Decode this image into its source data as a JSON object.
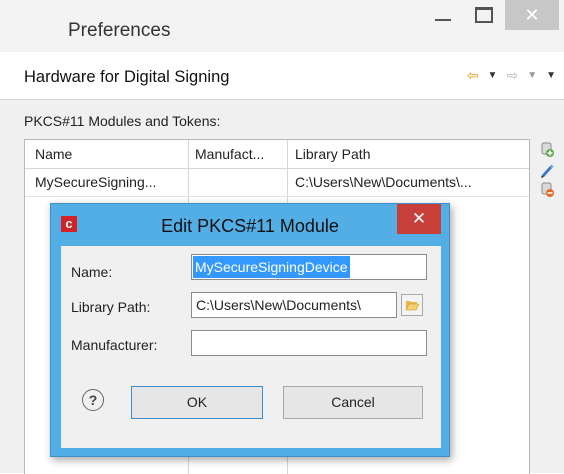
{
  "window": {
    "title": "Preferences",
    "minimize_icon": "minimize-icon",
    "maximize_icon": "maximize-icon",
    "close_label": "✕"
  },
  "page": {
    "header_title": "Hardware for Digital Signing",
    "section_label": "PKCS#11 Modules and Tokens:"
  },
  "nav": {
    "back_glyph": "⇦",
    "forward_glyph": "⇨",
    "dropdown_glyph": "▼"
  },
  "table": {
    "columns": [
      "Name",
      "Manufact...",
      "Library Path"
    ],
    "rows": [
      {
        "name": "MySecureSigning...",
        "manufacturer": "",
        "library_path": "C:\\Users\\New\\Documents\\..."
      }
    ]
  },
  "side_tools": [
    "add-module-icon",
    "edit-pencil-icon",
    "remove-module-icon"
  ],
  "dialog": {
    "title": "Edit PKCS#11 Module",
    "app_icon_letter": "c",
    "close_label": "✕",
    "fields": {
      "name_label": "Name:",
      "name_value": "MySecureSigningDevice",
      "library_label": "Library Path:",
      "library_value": "C:\\Users\\New\\Documents\\",
      "manufacturer_label": "Manufacturer:",
      "manufacturer_value": ""
    },
    "help_label": "?",
    "ok_label": "OK",
    "cancel_label": "Cancel"
  },
  "colors": {
    "dialog_frame": "#54aee6",
    "dialog_close": "#c83f39",
    "selection": "#3399ff",
    "app_icon": "#d42126",
    "nav_back": "#e3a31a"
  }
}
